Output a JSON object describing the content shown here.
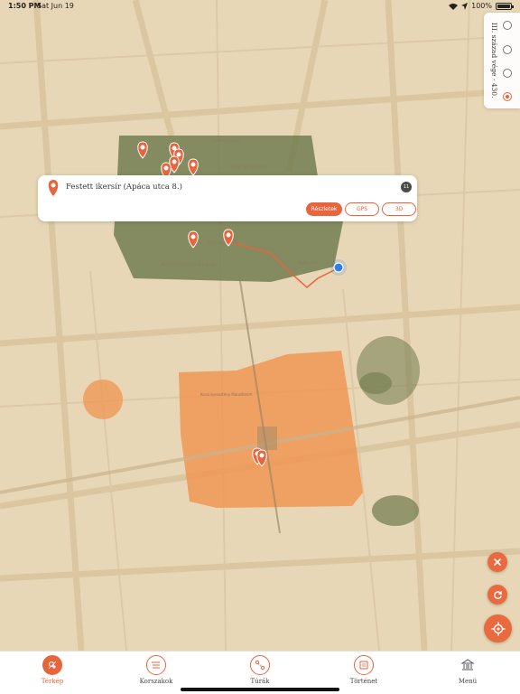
{
  "status_bar": {
    "time": "1:50 PM",
    "date": "Sat Jun 19",
    "battery": "100%"
  },
  "era_selector": {
    "label": "III. század vége - 430.",
    "options_count": 4,
    "selected_index": 3
  },
  "info_card": {
    "title": "Festett ikersír (Apáca utca 8.)",
    "badge": "11",
    "buttons": {
      "details": "Részletek",
      "gps": "GPS",
      "three_d": "3D"
    }
  },
  "map": {
    "colors": {
      "parchment": "#e8d7b6",
      "green_zone": "#6f7a4d",
      "orange_zone": "#f09450",
      "accent": "#e8643a",
      "user_dot": "#2f7fe8"
    },
    "labels": [
      "Székesegyház",
      "Római kori Sírkamra",
      "Mária-Ó-Keresztény Sírkápolna",
      "Cella Septichora",
      "Korai keresztény Mauzóleum",
      "Apáca utca"
    ],
    "icons": [
      "pin-icon",
      "user-location-icon"
    ]
  },
  "fabs": {
    "close": "close-icon",
    "refresh": "refresh-icon",
    "locate": "crosshair-icon"
  },
  "tabs": [
    {
      "label": "Térkép",
      "icon": "map-icon",
      "active": true
    },
    {
      "label": "Korszakok",
      "icon": "list-icon",
      "active": false
    },
    {
      "label": "Túrák",
      "icon": "route-icon",
      "active": false
    },
    {
      "label": "Történet",
      "icon": "book-icon",
      "active": false
    },
    {
      "label": "Menü",
      "icon": "museum-icon",
      "active": false
    }
  ]
}
